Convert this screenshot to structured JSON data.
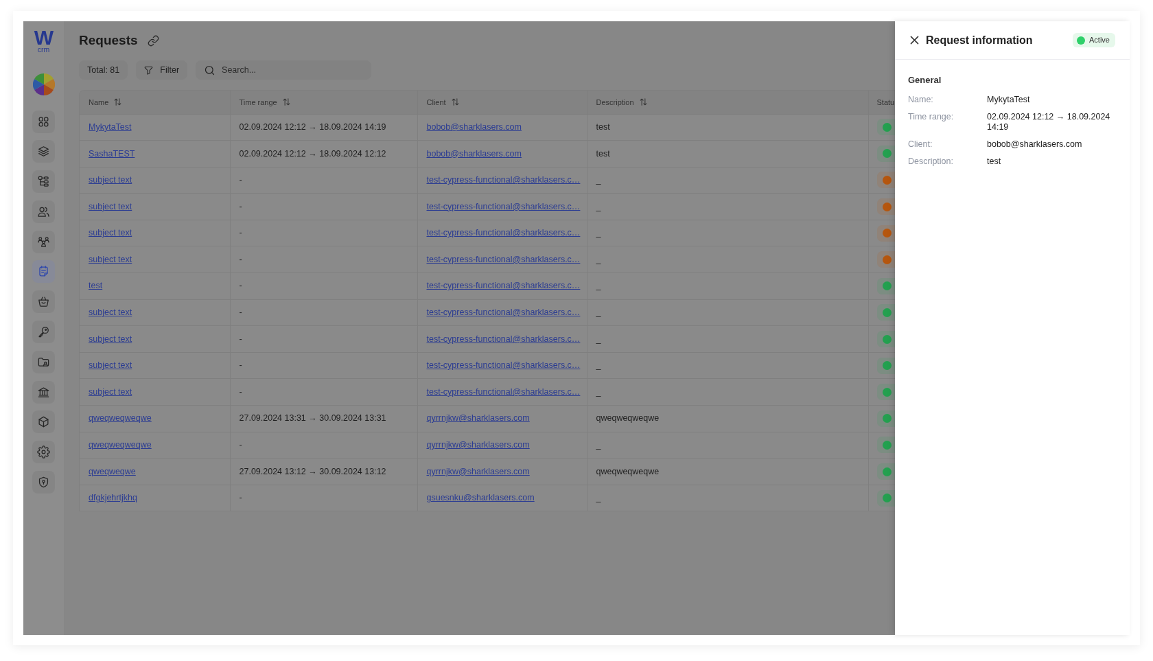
{
  "sidebar": {
    "logo": {
      "mark": "W",
      "caption": "crm"
    },
    "items": [
      {
        "selected": false
      },
      {
        "selected": false
      },
      {
        "selected": false
      },
      {
        "selected": false
      },
      {
        "selected": false
      },
      {
        "selected": true
      },
      {
        "selected": false
      },
      {
        "selected": false
      },
      {
        "selected": false
      },
      {
        "selected": false
      },
      {
        "selected": false
      },
      {
        "selected": false
      },
      {
        "selected": false
      }
    ]
  },
  "header": {
    "title": "Requests",
    "total": "Total: 81",
    "filter_button": "Filter",
    "search": {
      "placeholder": "Search..."
    }
  },
  "table": {
    "columns": [
      {
        "label": "Name",
        "sortable": true
      },
      {
        "label": "Time range",
        "sortable": true
      },
      {
        "label": "Client",
        "sortable": true
      },
      {
        "label": "Description",
        "sortable": true
      },
      {
        "label": "Statu",
        "sortable": false
      }
    ],
    "rows": [
      {
        "name": "MykytaTest",
        "time_range": "02.09.2024 12:12 → 18.09.2024 14:19",
        "client": "bobob@sharklasers.com",
        "description": "test",
        "color": "#23a04f"
      },
      {
        "name": "SashaTEST",
        "time_range": "02.09.2024 12:12 → 18.09.2024 12:12",
        "client": "bobob@sharklasers.com",
        "description": "test",
        "color": "#23a04f"
      },
      {
        "name": "subject text",
        "time_range": "-",
        "client": "test-cypress-functional@sharklasers.c…",
        "description": "_",
        "color": "#b5560e"
      },
      {
        "name": "subject text",
        "time_range": "-",
        "client": "test-cypress-functional@sharklasers.c…",
        "description": "_",
        "color": "#b5560e"
      },
      {
        "name": "subject text",
        "time_range": "-",
        "client": "test-cypress-functional@sharklasers.c…",
        "description": "_",
        "color": "#b5560e"
      },
      {
        "name": "subject text",
        "time_range": "-",
        "client": "test-cypress-functional@sharklasers.c…",
        "description": "_",
        "color": "#b5560e"
      },
      {
        "name": "test",
        "time_range": "-",
        "client": "test-cypress-functional@sharklasers.c…",
        "description": "_",
        "color": "#23a04f"
      },
      {
        "name": "subject text",
        "time_range": "-",
        "client": "test-cypress-functional@sharklasers.c…",
        "description": "_",
        "color": "#23a04f"
      },
      {
        "name": "subject text",
        "time_range": "-",
        "client": "test-cypress-functional@sharklasers.c…",
        "description": "_",
        "color": "#23a04f"
      },
      {
        "name": "subject text",
        "time_range": "-",
        "client": "test-cypress-functional@sharklasers.c…",
        "description": "_",
        "color": "#23a04f"
      },
      {
        "name": "subject text",
        "time_range": "-",
        "client": "test-cypress-functional@sharklasers.c…",
        "description": "_",
        "color": "#23a04f"
      },
      {
        "name": "qweqweqweqwe",
        "time_range": "27.09.2024 13:31 → 30.09.2024 13:31",
        "client": "qyrrnjkw@sharklasers.com",
        "description": "qweqweqweqwe",
        "color": "#23a04f"
      },
      {
        "name": "qweqweqweqwe",
        "time_range": "-",
        "client": "qyrrnjkw@sharklasers.com",
        "description": "_",
        "color": "#23a04f"
      },
      {
        "name": "qweqweqwe",
        "time_range": "27.09.2024 13:12 → 30.09.2024 13:12",
        "client": "qyrrnjkw@sharklasers.com",
        "description": "qweqweqweqwe",
        "color": "#23a04f"
      },
      {
        "name": "dfgkjehrtjkhq",
        "time_range": "-",
        "client": "gsuesnku@sharklasers.com",
        "description": "_",
        "color": "#23a04f"
      }
    ]
  },
  "drawer": {
    "title": "Request information",
    "status": "Active",
    "section": "General",
    "fields": [
      {
        "label": "Name:",
        "value": "MykytaTest"
      },
      {
        "label": "Time range:",
        "value": "02.09.2024 12:12 → 18.09.2024 14:19"
      },
      {
        "label": "Client:",
        "value": "bobob@sharklasers.com"
      },
      {
        "label": "Description:",
        "value": "test"
      }
    ]
  }
}
